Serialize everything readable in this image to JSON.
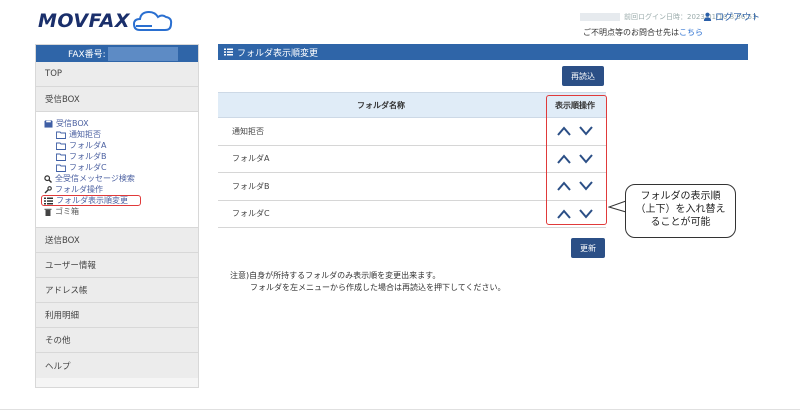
{
  "header": {
    "logo_text": "MOVFAX",
    "last_login_label": "前回ログイン日時：2023/01/10 8:36:53",
    "logout_label": "ログアウト",
    "contact_prefix": "ご不明点等のお問合せ先は",
    "contact_link": "こちら"
  },
  "sidebar": {
    "fax_label": "FAX番号:",
    "top": "TOP",
    "inbox_header": "受信BOX",
    "tree": {
      "inbox": "受信BOX",
      "folders": [
        "通知拒否",
        "フォルダA",
        "フォルダB",
        "フォルダC"
      ],
      "search_all": "全受信メッセージ検索",
      "folder_ops": "フォルダ操作",
      "reorder": "フォルダ表示順変更",
      "trash": "ゴミ箱"
    },
    "items": [
      "送信BOX",
      "ユーザー情報",
      "アドレス帳",
      "利用明細",
      "その他",
      "ヘルプ"
    ]
  },
  "main": {
    "title": "フォルダ表示順変更",
    "reload_button": "再読込",
    "update_button": "更新",
    "table": {
      "col_name": "フォルダ名称",
      "col_ops": "表示順操作",
      "rows": [
        "通知拒否",
        "フォルダA",
        "フォルダB",
        "フォルダC"
      ]
    },
    "note_line1": "注意)自身が所持するフォルダのみ表示順を変更出来ます。",
    "note_line2": "フォルダを左メニューから作成した場合は再読込を押下してください。"
  },
  "callout": {
    "line1": "フォルダの表示順",
    "line2": "（上下）を入れ替え",
    "line3": "ることが可能"
  },
  "colors": {
    "brand_blue": "#2f65a8",
    "button_navy": "#2b4f86",
    "highlight_red": "#e03a3a"
  }
}
